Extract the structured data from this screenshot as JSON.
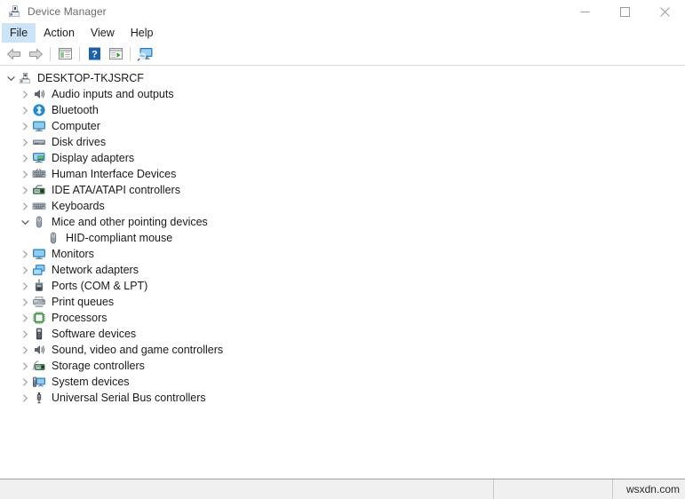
{
  "window": {
    "title": "Device Manager",
    "icon": "device-manager-icon",
    "controls": {
      "minimize": "minimize-icon",
      "maximize": "maximize-icon",
      "close": "close-icon"
    }
  },
  "menubar": {
    "items": [
      {
        "label": "File",
        "active": true
      },
      {
        "label": "Action",
        "active": false
      },
      {
        "label": "View",
        "active": false
      },
      {
        "label": "Help",
        "active": false
      }
    ]
  },
  "toolbar": {
    "buttons": [
      {
        "name": "back-arrow-icon",
        "tooltip": "Back"
      },
      {
        "name": "forward-arrow-icon",
        "tooltip": "Forward"
      },
      {
        "name": "show-hide-console-tree-icon",
        "tooltip": "Show/Hide Console Tree"
      },
      {
        "name": "help-icon",
        "tooltip": "Help"
      },
      {
        "name": "properties-icon",
        "tooltip": "Properties"
      },
      {
        "name": "scan-for-hardware-changes-icon",
        "tooltip": "Scan for hardware changes"
      }
    ]
  },
  "tree": {
    "root": {
      "label": "DESKTOP-TKJSRCF",
      "icon": "computer-root-icon",
      "expanded": true
    },
    "items": [
      {
        "label": "Audio inputs and outputs",
        "icon": "speaker-icon",
        "expanded": false,
        "level": 1
      },
      {
        "label": "Bluetooth",
        "icon": "bluetooth-icon",
        "expanded": false,
        "level": 1
      },
      {
        "label": "Computer",
        "icon": "computer-icon",
        "expanded": false,
        "level": 1
      },
      {
        "label": "Disk drives",
        "icon": "disk-drive-icon",
        "expanded": false,
        "level": 1
      },
      {
        "label": "Display adapters",
        "icon": "display-adapter-icon",
        "expanded": false,
        "level": 1
      },
      {
        "label": "Human Interface Devices",
        "icon": "hid-keyboard-icon",
        "expanded": false,
        "level": 1
      },
      {
        "label": "IDE ATA/ATAPI controllers",
        "icon": "ide-controller-icon",
        "expanded": false,
        "level": 1
      },
      {
        "label": "Keyboards",
        "icon": "keyboard-icon",
        "expanded": false,
        "level": 1
      },
      {
        "label": "Mice and other pointing devices",
        "icon": "mouse-icon",
        "expanded": true,
        "level": 1
      },
      {
        "label": "HID-compliant mouse",
        "icon": "mouse-icon",
        "expanded": null,
        "level": 2
      },
      {
        "label": "Monitors",
        "icon": "monitor-icon",
        "expanded": false,
        "level": 1
      },
      {
        "label": "Network adapters",
        "icon": "network-adapter-icon",
        "expanded": false,
        "level": 1
      },
      {
        "label": "Ports (COM & LPT)",
        "icon": "port-icon",
        "expanded": false,
        "level": 1
      },
      {
        "label": "Print queues",
        "icon": "printer-icon",
        "expanded": false,
        "level": 1
      },
      {
        "label": "Processors",
        "icon": "processor-icon",
        "expanded": false,
        "level": 1
      },
      {
        "label": "Software devices",
        "icon": "software-device-icon",
        "expanded": false,
        "level": 1
      },
      {
        "label": "Sound, video and game controllers",
        "icon": "speaker-icon",
        "expanded": false,
        "level": 1
      },
      {
        "label": "Storage controllers",
        "icon": "storage-controller-icon",
        "expanded": false,
        "level": 1
      },
      {
        "label": "System devices",
        "icon": "system-device-icon",
        "expanded": false,
        "level": 1
      },
      {
        "label": "Universal Serial Bus controllers",
        "icon": "usb-icon",
        "expanded": false,
        "level": 1
      }
    ]
  },
  "statusbar": {
    "main": "",
    "middle": "",
    "watermark": "wsxdn.com"
  },
  "colors": {
    "accent": "#cce4f7",
    "bluetooth_blue": "#1c8ad6",
    "monitor_blue": "#3ba7e8",
    "processor_green": "#3e8a3e",
    "text": "#1a1a1a",
    "title_text": "#6b6b6b",
    "statusbar_bg": "#f0f0f0"
  }
}
